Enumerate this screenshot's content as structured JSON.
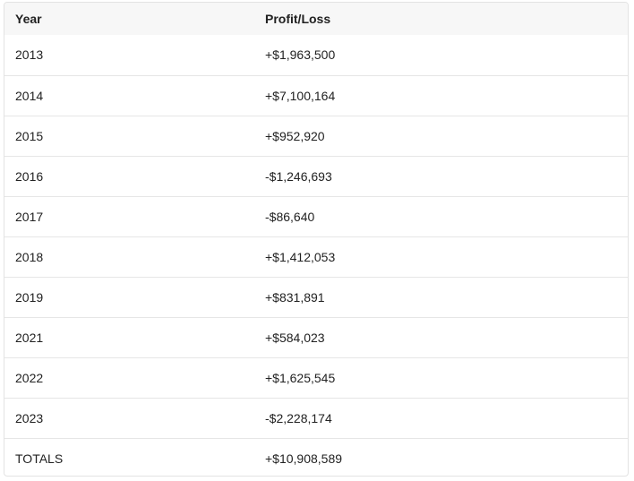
{
  "table": {
    "headers": {
      "year": "Year",
      "profit_loss": "Profit/Loss"
    },
    "rows": [
      {
        "year": "2013",
        "profit_loss": "+$1,963,500"
      },
      {
        "year": "2014",
        "profit_loss": "+$7,100,164"
      },
      {
        "year": "2015",
        "profit_loss": "+$952,920"
      },
      {
        "year": "2016",
        "profit_loss": "-$1,246,693"
      },
      {
        "year": "2017",
        "profit_loss": "-$86,640"
      },
      {
        "year": "2018",
        "profit_loss": "+$1,412,053"
      },
      {
        "year": "2019",
        "profit_loss": "+$831,891"
      },
      {
        "year": "2021",
        "profit_loss": "+$584,023"
      },
      {
        "year": "2022",
        "profit_loss": "+$1,625,545"
      },
      {
        "year": "2023",
        "profit_loss": "-$2,228,174"
      },
      {
        "year": "TOTALS",
        "profit_loss": "+$10,908,589"
      }
    ]
  }
}
